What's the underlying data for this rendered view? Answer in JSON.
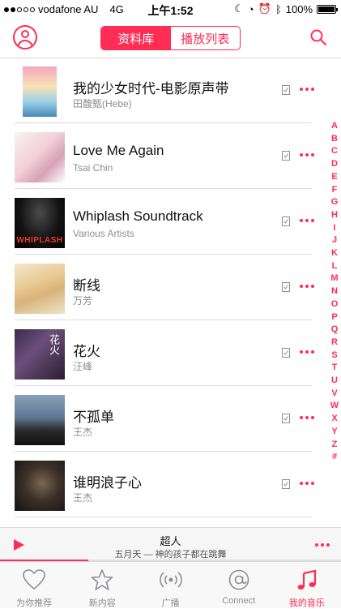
{
  "status_bar": {
    "carrier": "vodafone AU",
    "network": "4G",
    "time": "上午1:52",
    "battery": "100%",
    "battery_level": 1.0,
    "signal_bars": 2
  },
  "nav": {
    "segments": [
      "资料库",
      "播放列表"
    ],
    "active_segment": 0
  },
  "albums": [
    {
      "title": "我的少女时代-电影原声带",
      "artist": "田馥甄(Hebe)"
    },
    {
      "title": "Love Me Again",
      "artist": "Tsai Chin"
    },
    {
      "title": "Whiplash Soundtrack",
      "artist": "Various Artists",
      "cover_text": "WHIPLASH"
    },
    {
      "title": "断线",
      "artist": "万芳"
    },
    {
      "title": "花火",
      "artist": "汪峰",
      "cover_text": "花火"
    },
    {
      "title": "不孤单",
      "artist": "王杰"
    },
    {
      "title": "谁明浪子心",
      "artist": "王杰"
    }
  ],
  "index_letters": [
    "A",
    "B",
    "C",
    "D",
    "E",
    "F",
    "G",
    "H",
    "I",
    "J",
    "K",
    "L",
    "M",
    "N",
    "O",
    "P",
    "Q",
    "R",
    "S",
    "T",
    "U",
    "V",
    "W",
    "X",
    "Y",
    "Z",
    "#"
  ],
  "now_playing": {
    "song": "超人",
    "subtitle": "五月天 — 神的孩子都在跳舞",
    "progress": 0.26
  },
  "tabs": [
    {
      "label": "为你推荐",
      "icon": "heart-icon"
    },
    {
      "label": "新内容",
      "icon": "star-icon"
    },
    {
      "label": "广播",
      "icon": "radio-icon"
    },
    {
      "label": "Connect",
      "icon": "at-icon"
    },
    {
      "label": "我的音乐",
      "icon": "music-note-icon"
    }
  ],
  "active_tab": 4,
  "colors": {
    "accent": "#ff2d55",
    "secondary_text": "#8e8e93"
  }
}
